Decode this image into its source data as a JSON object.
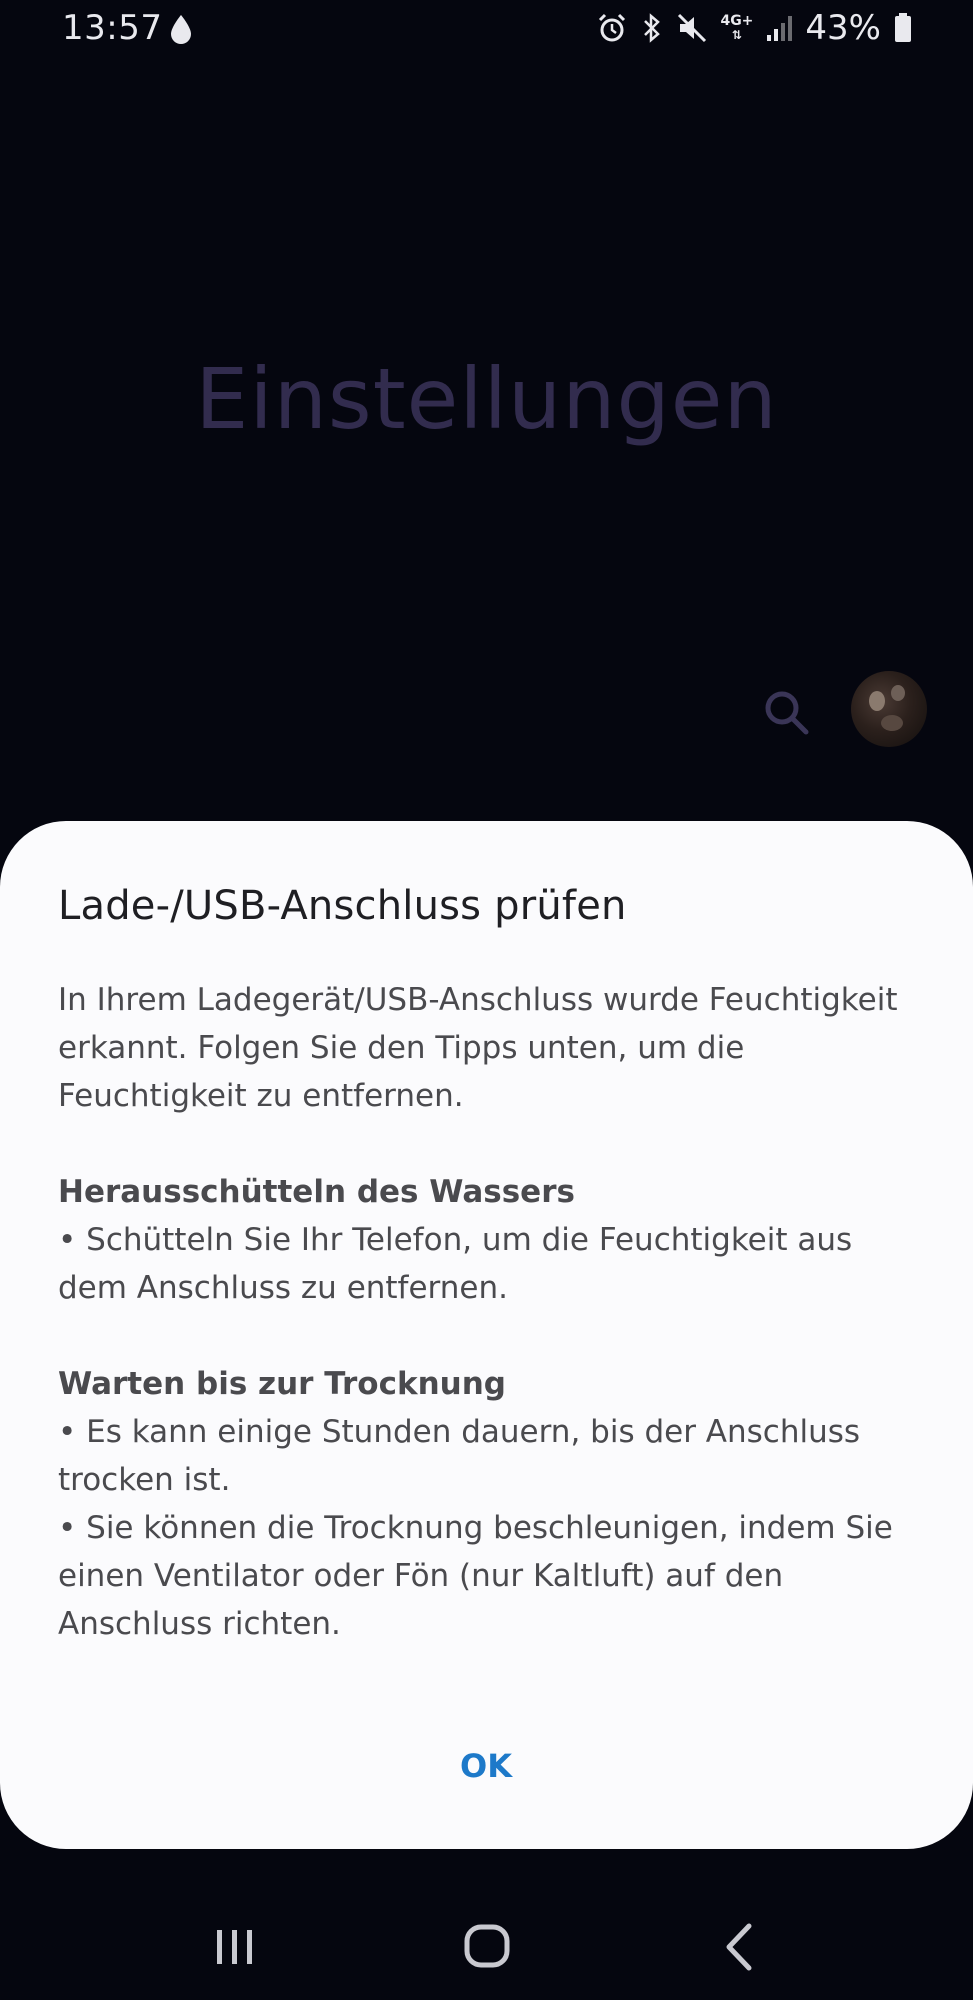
{
  "status_bar": {
    "time": "13:57",
    "network_type": "4G+",
    "battery_percent": "43%",
    "icons": [
      "water-drop-icon",
      "alarm-icon",
      "bluetooth-icon",
      "mute-icon",
      "network-4g-icon",
      "signal-icon",
      "battery-icon"
    ]
  },
  "background_app": {
    "title": "Einstellungen",
    "icons": [
      "search-icon",
      "avatar"
    ]
  },
  "dialog": {
    "title": "Lade-/USB-Anschluss prüfen",
    "intro": "In Ihrem Ladegerät/USB-Anschluss wurde Feuchtigkeit erkannt. Folgen Sie den Tipps unten, um die Feuchtigkeit zu entfernen.",
    "sections": [
      {
        "heading": "Herausschütteln des Wassers",
        "bullets": [
          "• Schütteln Sie Ihr Telefon, um die Feuchtigkeit aus dem Anschluss zu entfernen."
        ]
      },
      {
        "heading": "Warten bis zur Trocknung",
        "bullets": [
          "• Es kann einige Stunden dauern, bis der Anschluss trocken ist.",
          "• Sie können die Trocknung beschleunigen, indem Sie einen Ventilator oder Fön (nur Kaltluft) auf den Anschluss richten."
        ]
      }
    ],
    "ok_label": "OK"
  },
  "nav_bar": {
    "buttons": [
      "recent-apps-icon",
      "home-icon",
      "back-icon"
    ]
  },
  "colors": {
    "background": "#05060f",
    "dialog_bg": "#fbfbfd",
    "accent": "#1d79c9",
    "bg_title": "#322c4e"
  }
}
